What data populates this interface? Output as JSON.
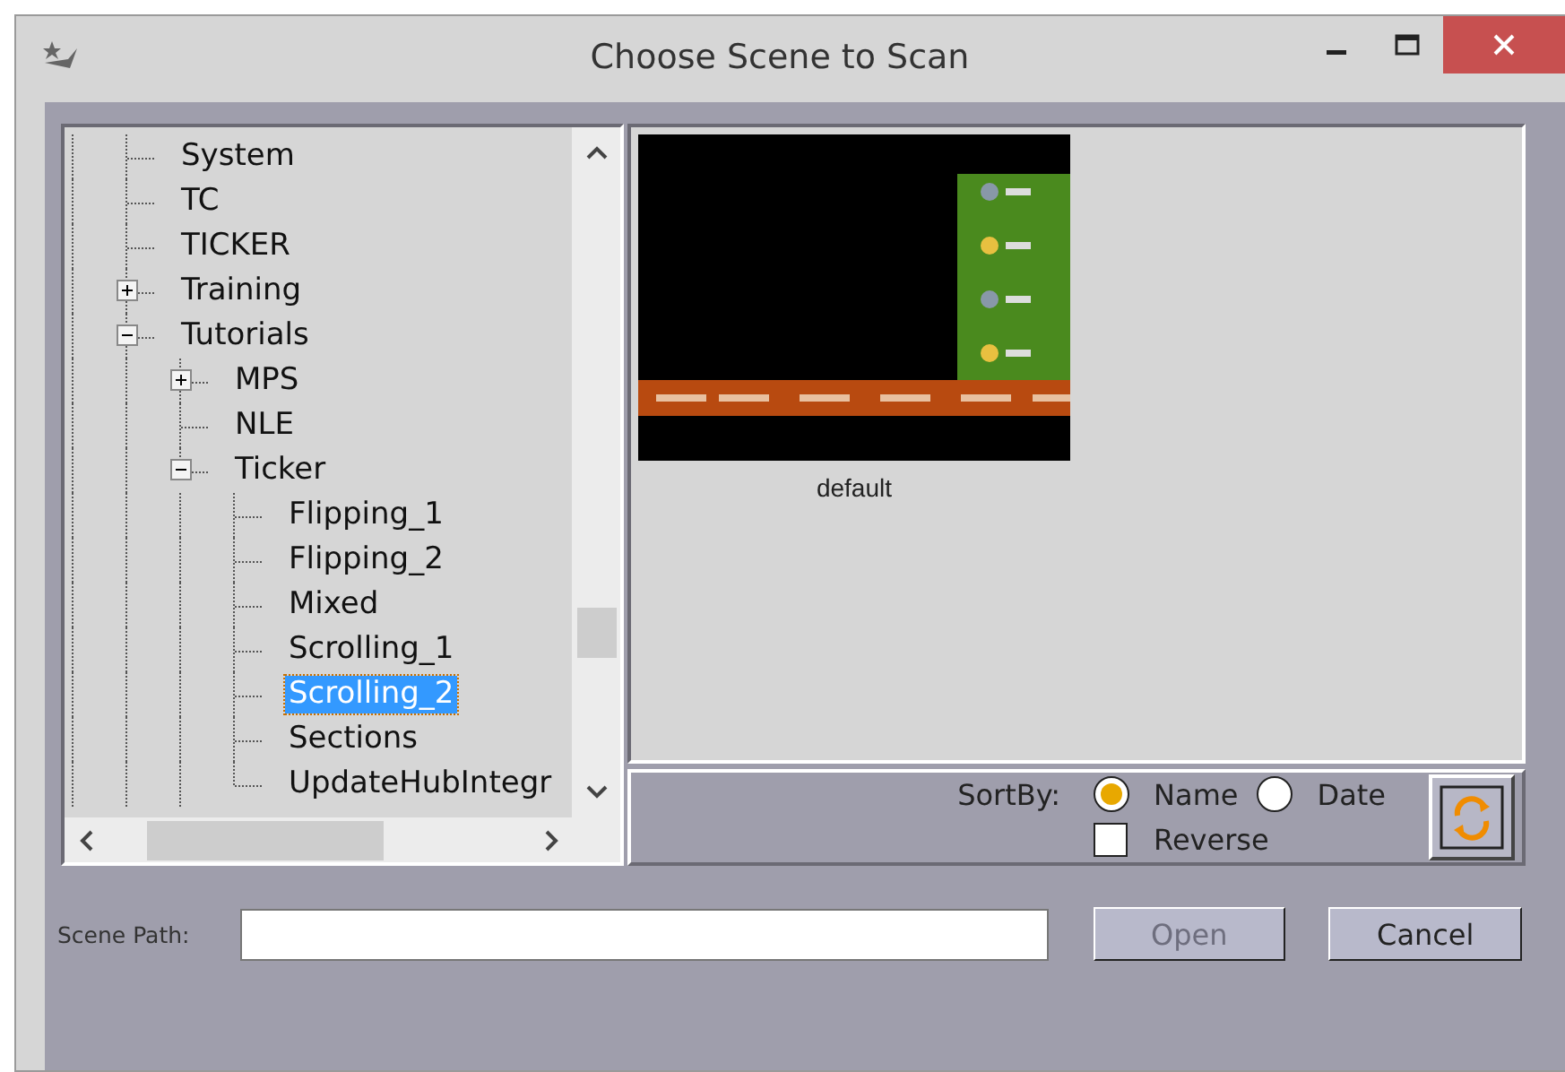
{
  "window": {
    "title": "Choose Scene to Scan"
  },
  "tree": [
    {
      "label": "System",
      "selected": false
    },
    {
      "label": "TC",
      "selected": false
    },
    {
      "label": "TICKER",
      "selected": false
    },
    {
      "label": "Training",
      "selected": false,
      "expanded": false
    },
    {
      "label": "Tutorials",
      "selected": false,
      "expanded": true,
      "children": [
        {
          "label": "MPS",
          "selected": false,
          "expanded": false
        },
        {
          "label": "NLE",
          "selected": false
        },
        {
          "label": "Ticker",
          "selected": false,
          "expanded": true,
          "children": [
            {
              "label": "Flipping_1",
              "selected": false
            },
            {
              "label": "Flipping_2",
              "selected": false
            },
            {
              "label": "Mixed",
              "selected": false
            },
            {
              "label": "Scrolling_1",
              "selected": false
            },
            {
              "label": "Scrolling_2",
              "selected": true
            },
            {
              "label": "Sections",
              "selected": false
            },
            {
              "label": "UpdateHubIntegr",
              "selected": false
            }
          ]
        }
      ]
    }
  ],
  "scenes": [
    {
      "name": "default"
    }
  ],
  "sort": {
    "label": "SortBy:",
    "options": [
      {
        "label": "Name",
        "selected": true
      },
      {
        "label": "Date",
        "selected": false
      }
    ],
    "reverse": {
      "label": "Reverse",
      "checked": false
    }
  },
  "scene_path": {
    "label": "Scene Path:"
  },
  "buttons": [
    {
      "label": "Open",
      "disabled": true
    },
    {
      "label": "Cancel",
      "disabled": false
    }
  ]
}
